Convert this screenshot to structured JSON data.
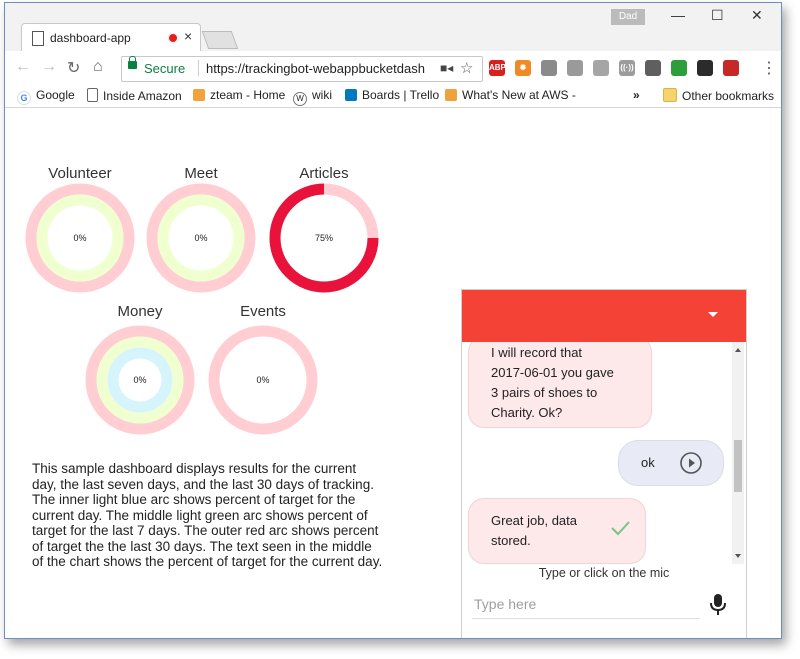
{
  "browser": {
    "tab_title": "dashboard-app",
    "tab_close": "×",
    "user_badge": "Dad",
    "window_controls": [
      "—",
      "☐",
      "✕"
    ],
    "nav_icons": [
      "back-icon",
      "forward-icon",
      "reload-icon",
      "home-icon"
    ],
    "secure_label": "Secure",
    "url": "https://trackingbot-webappbucketdash",
    "extensions": [
      {
        "name": "adblock-icon",
        "label": "ABP",
        "color": "#d6211f"
      },
      {
        "name": "sun-extension-icon",
        "label": "✹",
        "color": "#f08a24"
      },
      {
        "name": "gray-extension-icon",
        "label": "",
        "color": "#8a8a8a"
      },
      {
        "name": "box-extension-icon",
        "label": "",
        "color": "#9a9a9a"
      },
      {
        "name": "cloud-extension-icon",
        "label": "",
        "color": "#a5a5a5"
      },
      {
        "name": "radio-extension-icon",
        "label": "((·))",
        "color": "#9c9c9c"
      },
      {
        "name": "location-extension-icon",
        "label": "",
        "color": "#5f5f5f"
      },
      {
        "name": "green-extension-icon",
        "label": "",
        "color": "#2e9e3a"
      },
      {
        "name": "dark-extension-icon",
        "label": "",
        "color": "#2b2b2b"
      },
      {
        "name": "pdf-extension-icon",
        "label": "",
        "color": "#c62828"
      }
    ],
    "bookmarks": [
      {
        "label": "Google",
        "icon": "google-icon",
        "color": "#4285f4"
      },
      {
        "label": "Inside Amazon",
        "icon": "page-icon",
        "color": "#ffffff"
      },
      {
        "label": "zteam - Home",
        "icon": "amazon-icon",
        "color": "#f2a13b"
      },
      {
        "label": "wiki",
        "icon": "wiki-icon",
        "color": "#ffffff"
      },
      {
        "label": "Boards | Trello",
        "icon": "trello-icon",
        "color": "#0079bf"
      },
      {
        "label": "What's New at AWS -",
        "icon": "aws-icon",
        "color": "#f0a23a"
      }
    ],
    "bookmarks_overflow": "»",
    "other_bookmarks": "Other bookmarks"
  },
  "dashboard": {
    "colors": {
      "outer": "#ffcdd2",
      "middle": "#f0ffd0",
      "inner": "#d6f4fb",
      "progress": "#e8123a"
    },
    "gauges": [
      {
        "label": "Volunteer",
        "value_text": "0%",
        "outer": 0,
        "rings": 2
      },
      {
        "label": "Meet",
        "value_text": "0%",
        "outer": 0,
        "rings": 2
      },
      {
        "label": "Articles",
        "value_text": "75%",
        "outer": 0.75,
        "rings": 1
      },
      {
        "label": "Money",
        "value_text": "0%",
        "outer": 0,
        "rings": 3
      },
      {
        "label": "Events",
        "value_text": "0%",
        "outer": 0,
        "rings": 1
      }
    ],
    "description": "This sample dashboard displays results for the current day, the last seven days, and the last 30 days of tracking. The inner light blue arc shows percent of target for the current day. The middle light green arc shows percent of target for the last 7 days. The outer red arc shows percent of target the the last 30 days. The text seen in the middle of the chart shows the percent of target for the current day."
  },
  "chat": {
    "messages": [
      {
        "from": "bot",
        "lines": [
          "I will record that",
          "2017-06-01 you gave",
          "3 pairs of shoes to",
          "Charity. Ok?"
        ]
      },
      {
        "from": "user",
        "text": "ok"
      },
      {
        "from": "bot",
        "lines": [
          "Great job, data",
          "stored."
        ]
      }
    ],
    "hint": "Type or click on the mic",
    "input_placeholder": "Type here"
  }
}
